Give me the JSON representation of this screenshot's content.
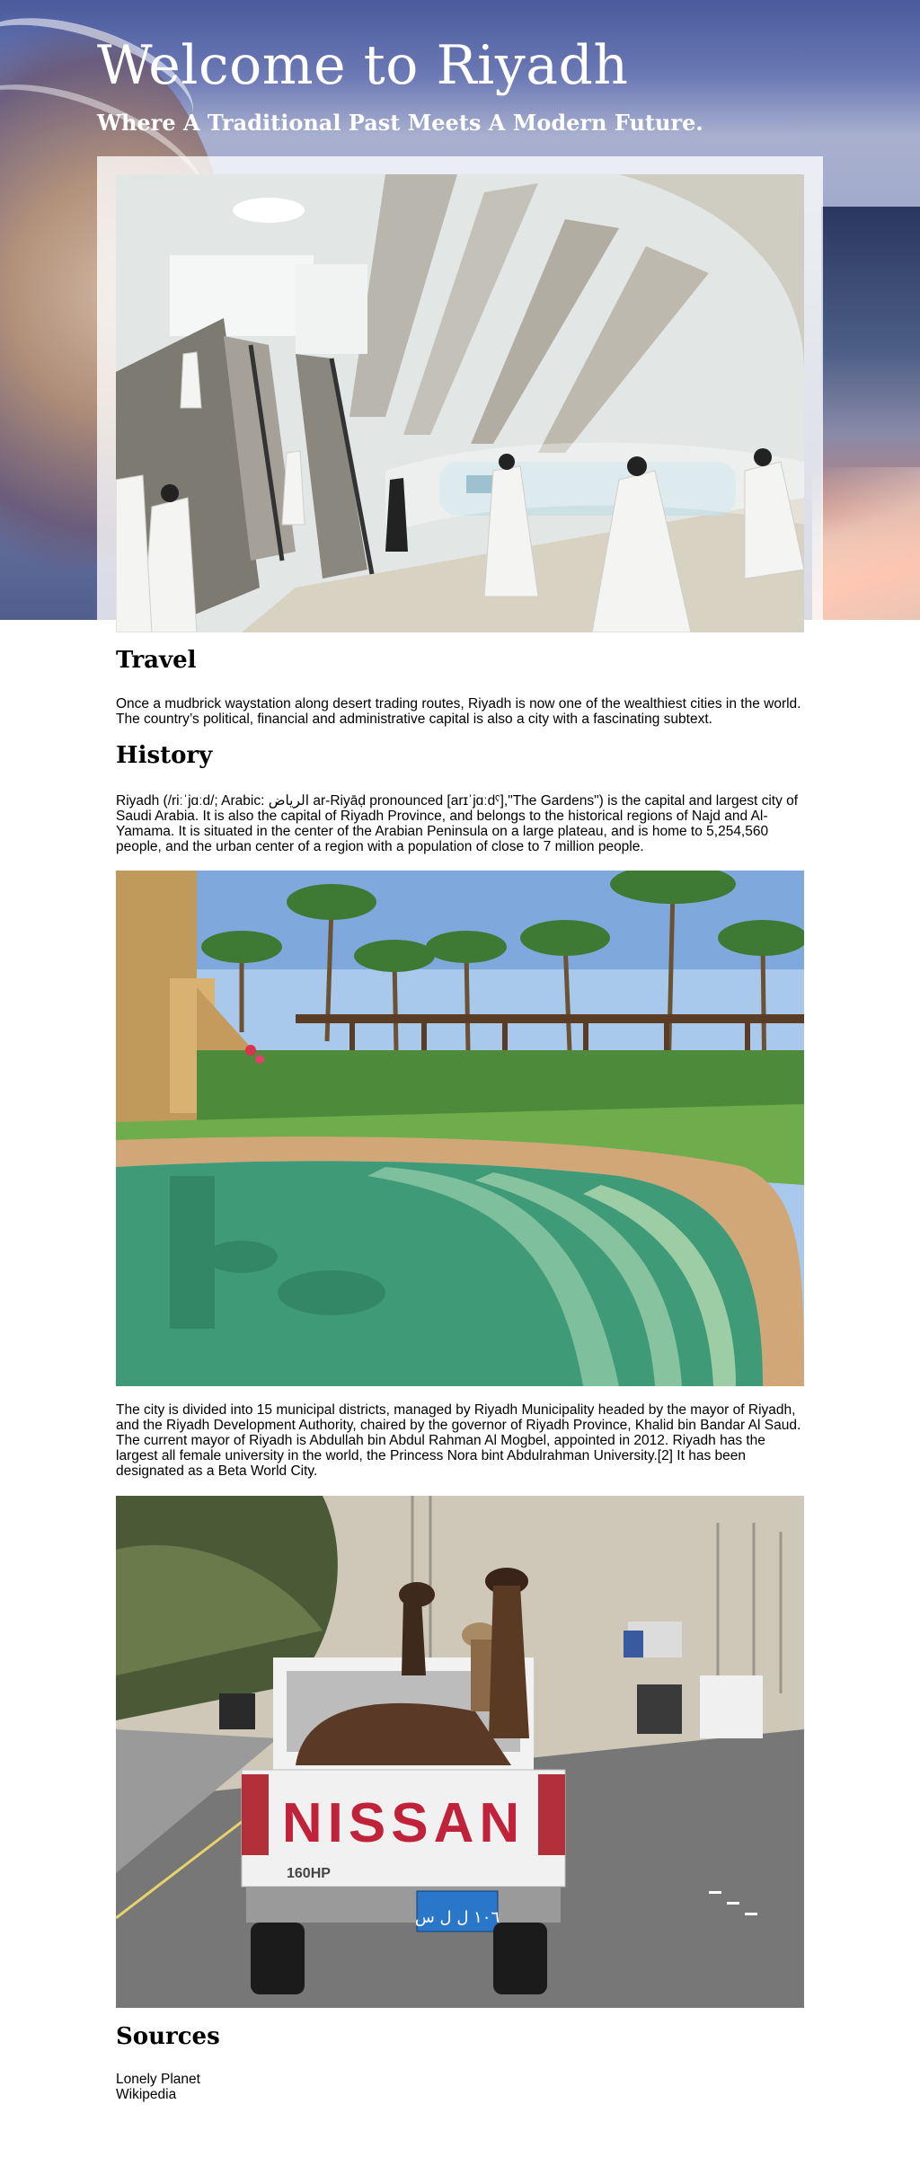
{
  "header": {
    "title": "Welcome to Riyadh",
    "subtitle": "Where A Traditional Past Meets A Modern Future."
  },
  "sections": {
    "travel": {
      "heading": "Travel",
      "text": "Once a mudbrick waystation along desert trading routes, Riyadh is now one of the wealthiest cities in the world. The country’s political, financial and administrative capital is also a city with a fascinating subtext."
    },
    "history": {
      "heading": "History",
      "text1": "Riyadh (/riːˈjɑːd/; Arabic: الرياض ar-Riyāḍ pronounced [arɪˈjɑːdˤ],\"The Gardens\") is the capital and largest city of Saudi Arabia. It is also the capital of Riyadh Province, and belongs to the historical regions of Najd and Al-Yamama. It is situated in the center of the Arabian Peninsula on a large plateau, and is home to 5,254,560 people, and the urban center of a region with a population of close to 7 million people.",
      "text2": "The city is divided into 15 municipal districts, managed by Riyadh Municipality headed by the mayor of Riyadh, and the Riyadh Development Authority, chaired by the governor of Riyadh Province, Khalid bin Bandar Al Saud. The current mayor of Riyadh is Abdullah bin Abdul Rahman Al Mogbel, appointed in 2012. Riyadh has the largest all female university in the world, the Princess Nora bint Abdulrahman University.[2] It has been designated as a Beta World City."
    },
    "sources": {
      "heading": "Sources",
      "items": [
        "Lonely Planet",
        "Wikipedia"
      ]
    }
  },
  "truck": {
    "brand": "NISSAN",
    "hp": "160HP",
    "plate": "١٠٦ ل ل س"
  }
}
